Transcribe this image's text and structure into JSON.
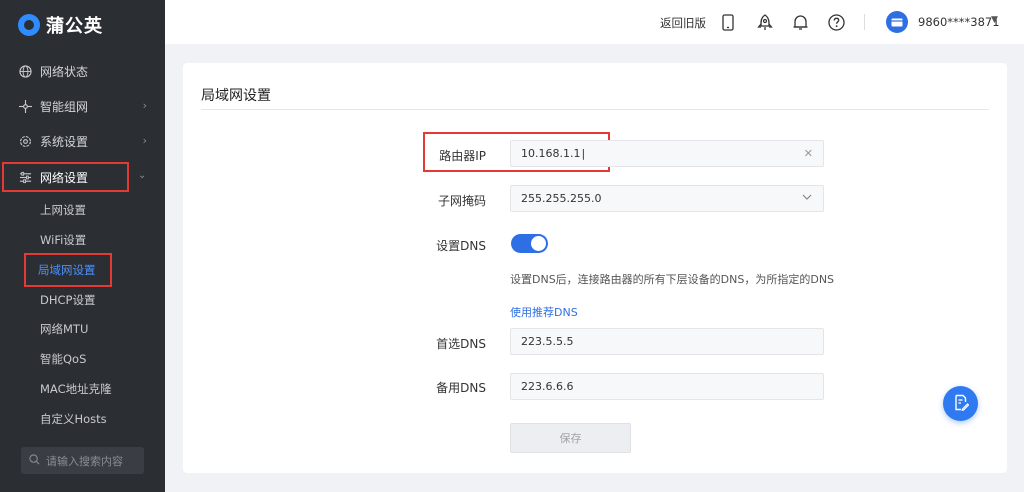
{
  "brand": {
    "name": "蒲公英"
  },
  "sidebar": {
    "menu": [
      {
        "label": "网络状态",
        "icon": "globe-icon"
      },
      {
        "label": "智能组网",
        "icon": "network-icon"
      },
      {
        "label": "系统设置",
        "icon": "gear-icon"
      },
      {
        "label": "网络设置",
        "icon": "sliders-icon"
      }
    ],
    "sub_items": [
      "上网设置",
      "WiFi设置",
      "局域网设置",
      "DHCP设置",
      "网络MTU",
      "智能QoS",
      "MAC地址克隆",
      "自定义Hosts"
    ],
    "search_placeholder": "请输入搜索内容"
  },
  "topbar": {
    "back_link": "返回旧版",
    "account": "9860****3871"
  },
  "page": {
    "title": "局域网设置",
    "router_ip_label": "路由器IP",
    "router_ip_value": "10.168.1.1",
    "subnet_label": "子网掩码",
    "subnet_value": "255.255.255.0",
    "dns_toggle_label": "设置DNS",
    "dns_toggle_on": true,
    "dns_hint": "设置DNS后，连接路由器的所有下层设备的DNS，为所指定的DNS",
    "recommended_dns_link": "使用推荐DNS",
    "primary_dns_label": "首选DNS",
    "primary_dns_value": "223.5.5.5",
    "secondary_dns_label": "备用DNS",
    "secondary_dns_value": "223.6.6.6",
    "save_label": "保存"
  },
  "colors": {
    "accent": "#2f6fe4",
    "sidebar_bg": "#2b2e33",
    "highlight": "#e53935"
  }
}
